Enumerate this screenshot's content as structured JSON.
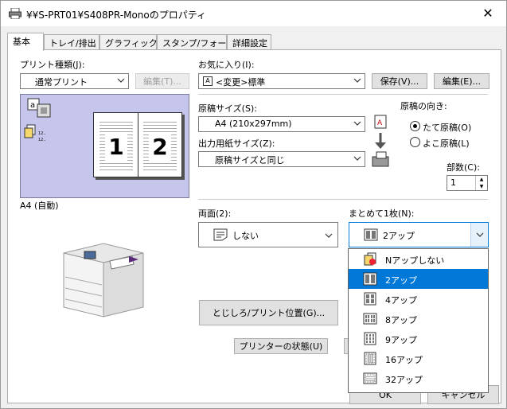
{
  "window": {
    "title": "¥¥S-PRT01¥S408PR-Monoのプロパティ",
    "close_glyph": "✕"
  },
  "tabs": [
    "基本",
    "トレイ/排出",
    "グラフィックス",
    "スタンプ/フォーム",
    "詳細設定"
  ],
  "print_type": {
    "label": "プリント種類(J):",
    "value": "通常プリント",
    "edit_button": "編集(T)..."
  },
  "favorites": {
    "label": "お気に入り(I):",
    "value": "<変更>標準",
    "save_button": "保存(V)...",
    "edit_button": "編集(E)..."
  },
  "original_size": {
    "label": "原稿サイズ(S):",
    "value": "A4 (210x297mm)"
  },
  "output_size": {
    "label": "出力用紙サイズ(Z):",
    "value": "原稿サイズと同じ"
  },
  "orientation": {
    "label": "原稿の向き:",
    "portrait": "たて原稿(O)",
    "landscape": "よこ原稿(L)",
    "selected": "portrait"
  },
  "copies": {
    "label": "部数(C):",
    "value": "1"
  },
  "preview": {
    "paper_label": "A4 (自動)",
    "page_numbers": [
      "1",
      "2"
    ]
  },
  "duplex": {
    "label": "両面(2):",
    "value": "しない"
  },
  "nup": {
    "label": "まとめて1枚(N):",
    "value": "2アップ",
    "options": [
      "Nアップしない",
      "2アップ",
      "4アップ",
      "8アップ",
      "9アップ",
      "16アップ",
      "32アップ"
    ],
    "selected_index": 1
  },
  "buttons": {
    "margin": "とじしろ/プリント位置(G)...",
    "printer_status": "プリンターの状態(U)",
    "ok": "OK",
    "cancel": "キャンセル"
  },
  "colors": {
    "accent": "#0078d7",
    "preview_bg": "#c6c6ec"
  }
}
